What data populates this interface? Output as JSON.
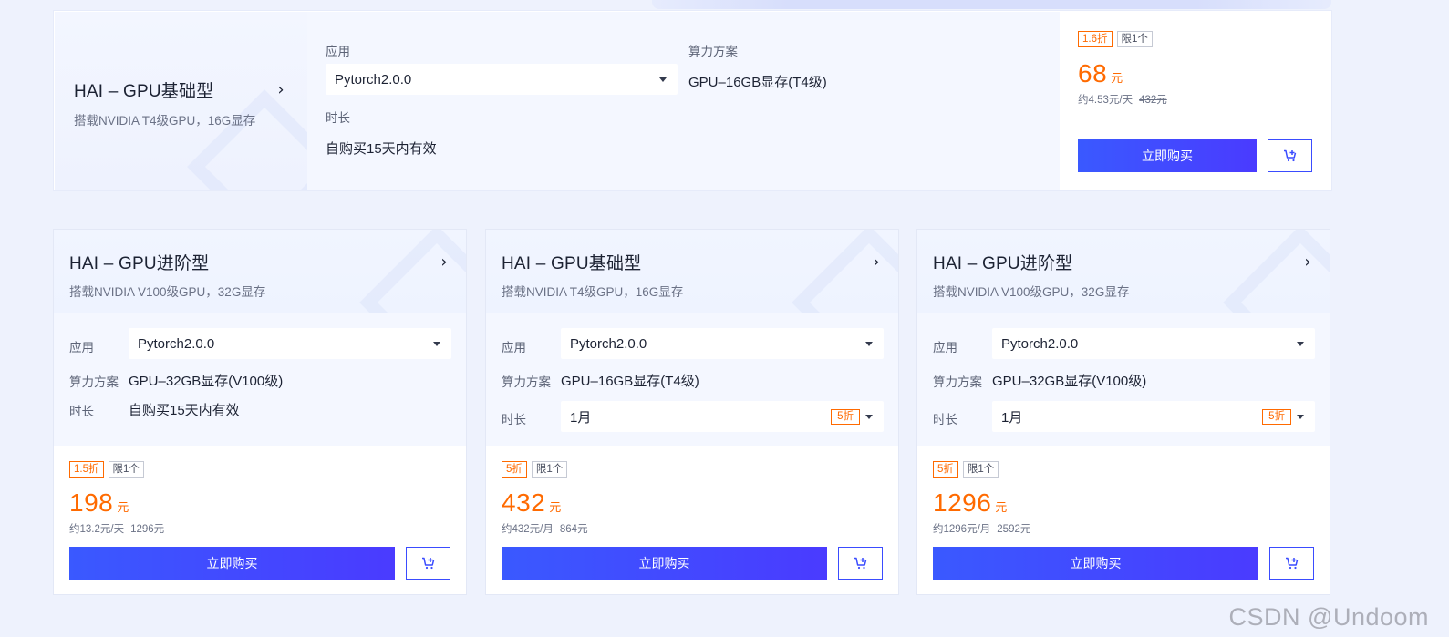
{
  "wide_card": {
    "title": "HAI – GPU基础型",
    "subtitle": "搭载NVIDIA T4级GPU，16G显存",
    "app_label": "应用",
    "app_value": "Pytorch2.0.0",
    "compute_label": "算力方案",
    "compute_value": "GPU–16GB显存(T4级)",
    "duration_label": "时长",
    "duration_value": "自购买15天内有效",
    "discount_tag": "1.6折",
    "limit_tag": "限1个",
    "price": "68",
    "price_unit": "元",
    "per_unit": "约4.53元/天",
    "original_price": "432元",
    "buy_label": "立即购买"
  },
  "cards": [
    {
      "title": "HAI – GPU进阶型",
      "subtitle": "搭载NVIDIA V100级GPU，32G显存",
      "app_label": "应用",
      "app_value": "Pytorch2.0.0",
      "compute_label": "算力方案",
      "compute_value": "GPU–32GB显存(V100级)",
      "duration_label": "时长",
      "duration_value": "自购买15天内有效",
      "discount_tag": "1.5折",
      "limit_tag": "限1个",
      "price": "198",
      "price_unit": "元",
      "per_unit": "约13.2元/天",
      "original_price": "1296元",
      "buy_label": "立即购买"
    },
    {
      "title": "HAI – GPU基础型",
      "subtitle": "搭载NVIDIA T4级GPU，16G显存",
      "app_label": "应用",
      "app_value": "Pytorch2.0.0",
      "compute_label": "算力方案",
      "compute_value": "GPU–16GB显存(T4级)",
      "duration_label": "时长",
      "duration_value": "1月",
      "duration_discount": "5折",
      "discount_tag": "5折",
      "limit_tag": "限1个",
      "price": "432",
      "price_unit": "元",
      "per_unit": "约432元/月",
      "original_price": "864元",
      "buy_label": "立即购买"
    },
    {
      "title": "HAI – GPU进阶型",
      "subtitle": "搭载NVIDIA V100级GPU，32G显存",
      "app_label": "应用",
      "app_value": "Pytorch2.0.0",
      "compute_label": "算力方案",
      "compute_value": "GPU–32GB显存(V100级)",
      "duration_label": "时长",
      "duration_value": "1月",
      "duration_discount": "5折",
      "discount_tag": "5折",
      "limit_tag": "限1个",
      "price": "1296",
      "price_unit": "元",
      "per_unit": "约1296元/月",
      "original_price": "2592元",
      "buy_label": "立即购买"
    }
  ],
  "watermark": "CSDN @Undoom",
  "icons": {
    "chevron": "chevron-right-icon",
    "cart": "cart-add-icon",
    "caret": "caret-down-icon"
  },
  "colors": {
    "accent": "#3a4cff",
    "price": "#ff6a00",
    "background": "#eef2fd"
  }
}
